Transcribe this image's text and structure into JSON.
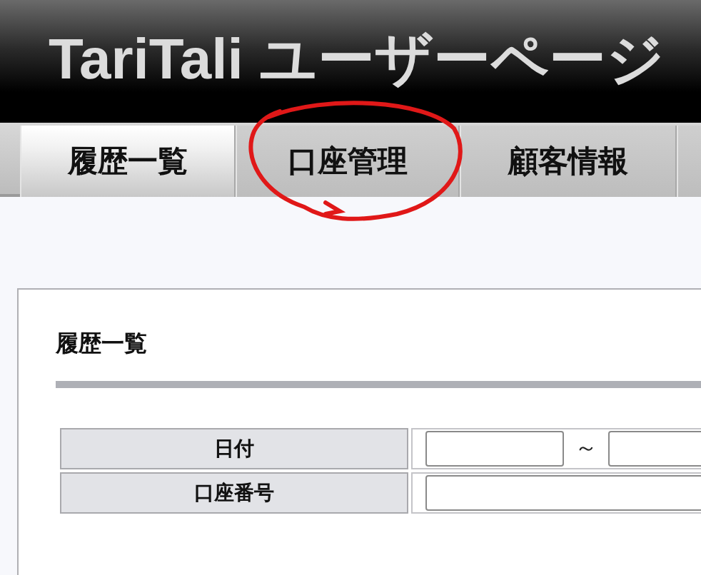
{
  "header": {
    "title": "TariTali ユーザーページ"
  },
  "tabs": [
    {
      "label": "履歴一覧",
      "selected": true
    },
    {
      "label": "口座管理",
      "selected": false,
      "circled": true
    },
    {
      "label": "顧客情報",
      "selected": false
    }
  ],
  "section": {
    "heading": "履歴一覧",
    "fields": [
      {
        "label": "日付",
        "kind": "range",
        "separator": "～"
      },
      {
        "label": "口座番号",
        "kind": "text"
      }
    ]
  }
}
